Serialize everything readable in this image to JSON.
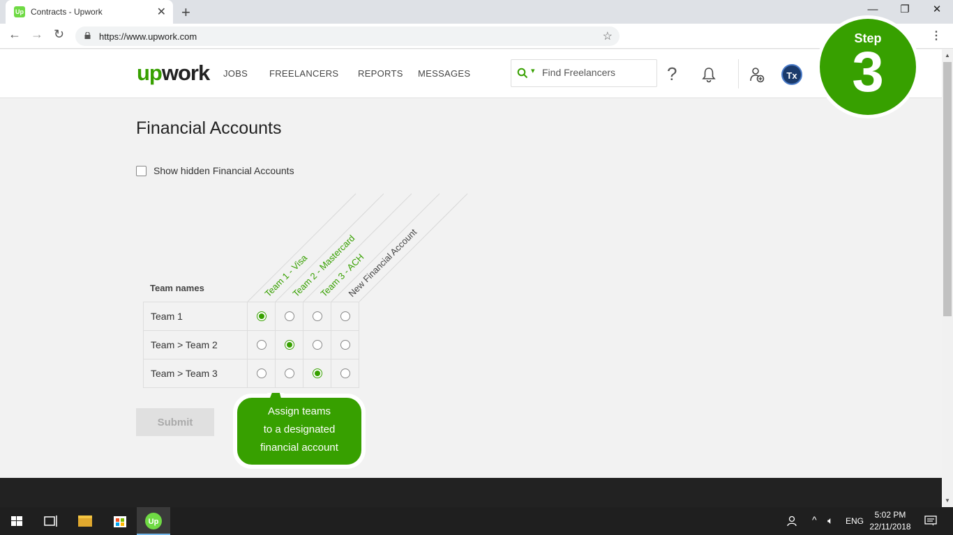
{
  "browser": {
    "tab_title": "Contracts - Upwork",
    "tab_favicon": "Up",
    "url": "https://www.upwork.com"
  },
  "header": {
    "logo_up": "up",
    "logo_work": "work",
    "nav": [
      "JOBS",
      "FREELANCERS",
      "REPORTS",
      "MESSAGES"
    ],
    "search_placeholder": "Find Freelancers",
    "avatar_initials": "Tx"
  },
  "step": {
    "word": "Step",
    "number": "3"
  },
  "page": {
    "title": "Financial Accounts",
    "show_hidden_label": "Show hidden Financial Accounts",
    "show_hidden_checked": false,
    "team_names_label": "Team names",
    "accounts": [
      "Team 1 - Visa",
      "Team 2 - Mastercard",
      "Team 3 - ACH",
      "New Financial Account"
    ],
    "account_colors": [
      "#37a000",
      "#37a000",
      "#37a000",
      "#444444"
    ],
    "rows": [
      {
        "name": "Team 1",
        "selected": 0
      },
      {
        "name": "Team > Team 2",
        "selected": 1
      },
      {
        "name": "Team > Team 3",
        "selected": 2
      }
    ],
    "submit_label": "Submit"
  },
  "callout": {
    "lines": [
      "Assign teams",
      "to a designated",
      "financial account"
    ],
    "color": "#37a000"
  },
  "taskbar": {
    "language": "ENG",
    "time": "5:02 PM",
    "date": "22/11/2018"
  }
}
